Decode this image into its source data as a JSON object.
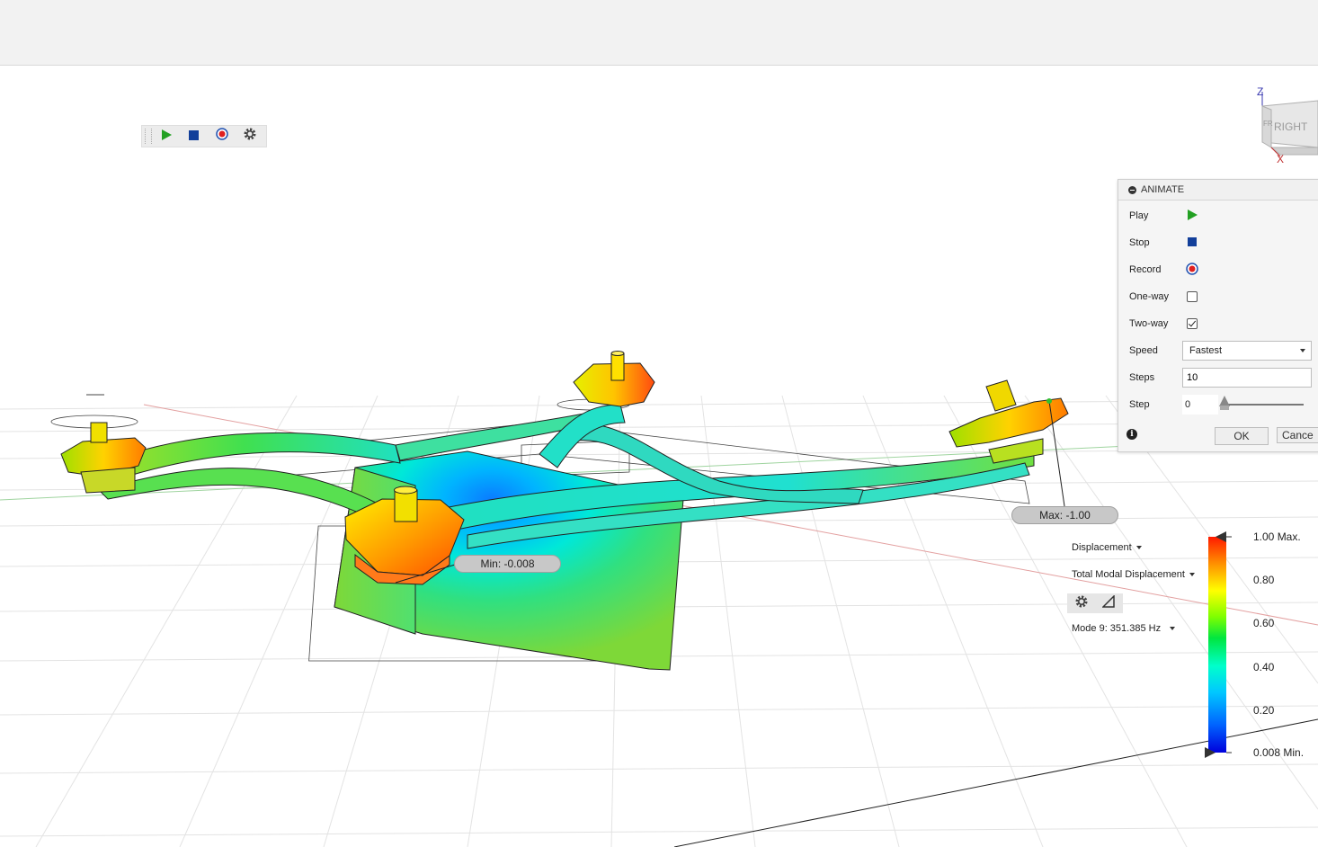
{
  "animate_panel": {
    "title": "ANIMATE",
    "rows": {
      "play": "Play",
      "stop": "Stop",
      "record": "Record",
      "one_way": "One-way",
      "two_way": "Two-way",
      "speed": "Speed",
      "steps": "Steps",
      "step": "Step"
    },
    "one_way_checked": false,
    "two_way_checked": true,
    "speed_value": "Fastest",
    "steps_value": "10",
    "step_value": "0",
    "step_slider_fraction": 0,
    "ok_label": "OK",
    "cancel_label": "Cance"
  },
  "results": {
    "result_type": "Displacement",
    "result_component": "Total Modal Displacement",
    "mode": "Mode 9: 351.385 Hz",
    "max_probe": "Max: -1.00",
    "min_probe": "Min: -0.008"
  },
  "legend": {
    "labels": [
      "1.00 Max.",
      "0.80",
      "0.60",
      "0.40",
      "0.20",
      "0.008 Min."
    ],
    "colors": [
      "#ff1a00",
      "#ffff00",
      "#00e640",
      "#00ffcc",
      "#0064ff",
      "#0000dc"
    ]
  },
  "viewcube": {
    "face": "RIGHT",
    "front_partial": "FR",
    "axis_z": "Z",
    "axis_x": "X"
  },
  "icons": [
    "play-icon",
    "stop-icon",
    "record-icon",
    "gear-icon",
    "info-icon",
    "probe-icon"
  ]
}
